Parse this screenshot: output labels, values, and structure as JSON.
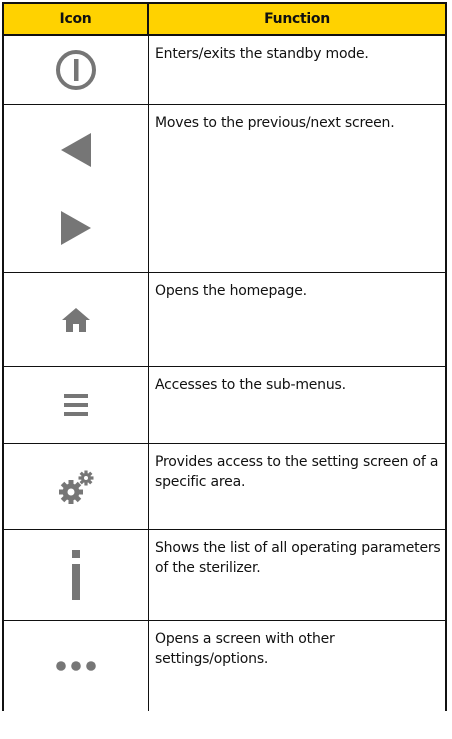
{
  "table": {
    "header": {
      "icon": "Icon",
      "function": "Function"
    },
    "header_color": "#ffd200",
    "icon_color": "#767676",
    "rows": [
      {
        "icons": [
          "power-icon"
        ],
        "function": "Enters/exits the standby mode."
      },
      {
        "icons": [
          "arrow-left-icon",
          "arrow-right-icon"
        ],
        "function": "Moves to the previous/next screen."
      },
      {
        "icons": [
          "home-icon"
        ],
        "function": "Opens the homepage."
      },
      {
        "icons": [
          "menu-icon"
        ],
        "function": "Accesses to the sub-menus."
      },
      {
        "icons": [
          "gears-icon"
        ],
        "function": "Provides access to the setting screen of a specific area."
      },
      {
        "icons": [
          "info-icon"
        ],
        "function": "Shows the list of all operating parameters of the sterilizer."
      },
      {
        "icons": [
          "more-icon"
        ],
        "function": "Opens a screen with other settings/options."
      }
    ]
  }
}
